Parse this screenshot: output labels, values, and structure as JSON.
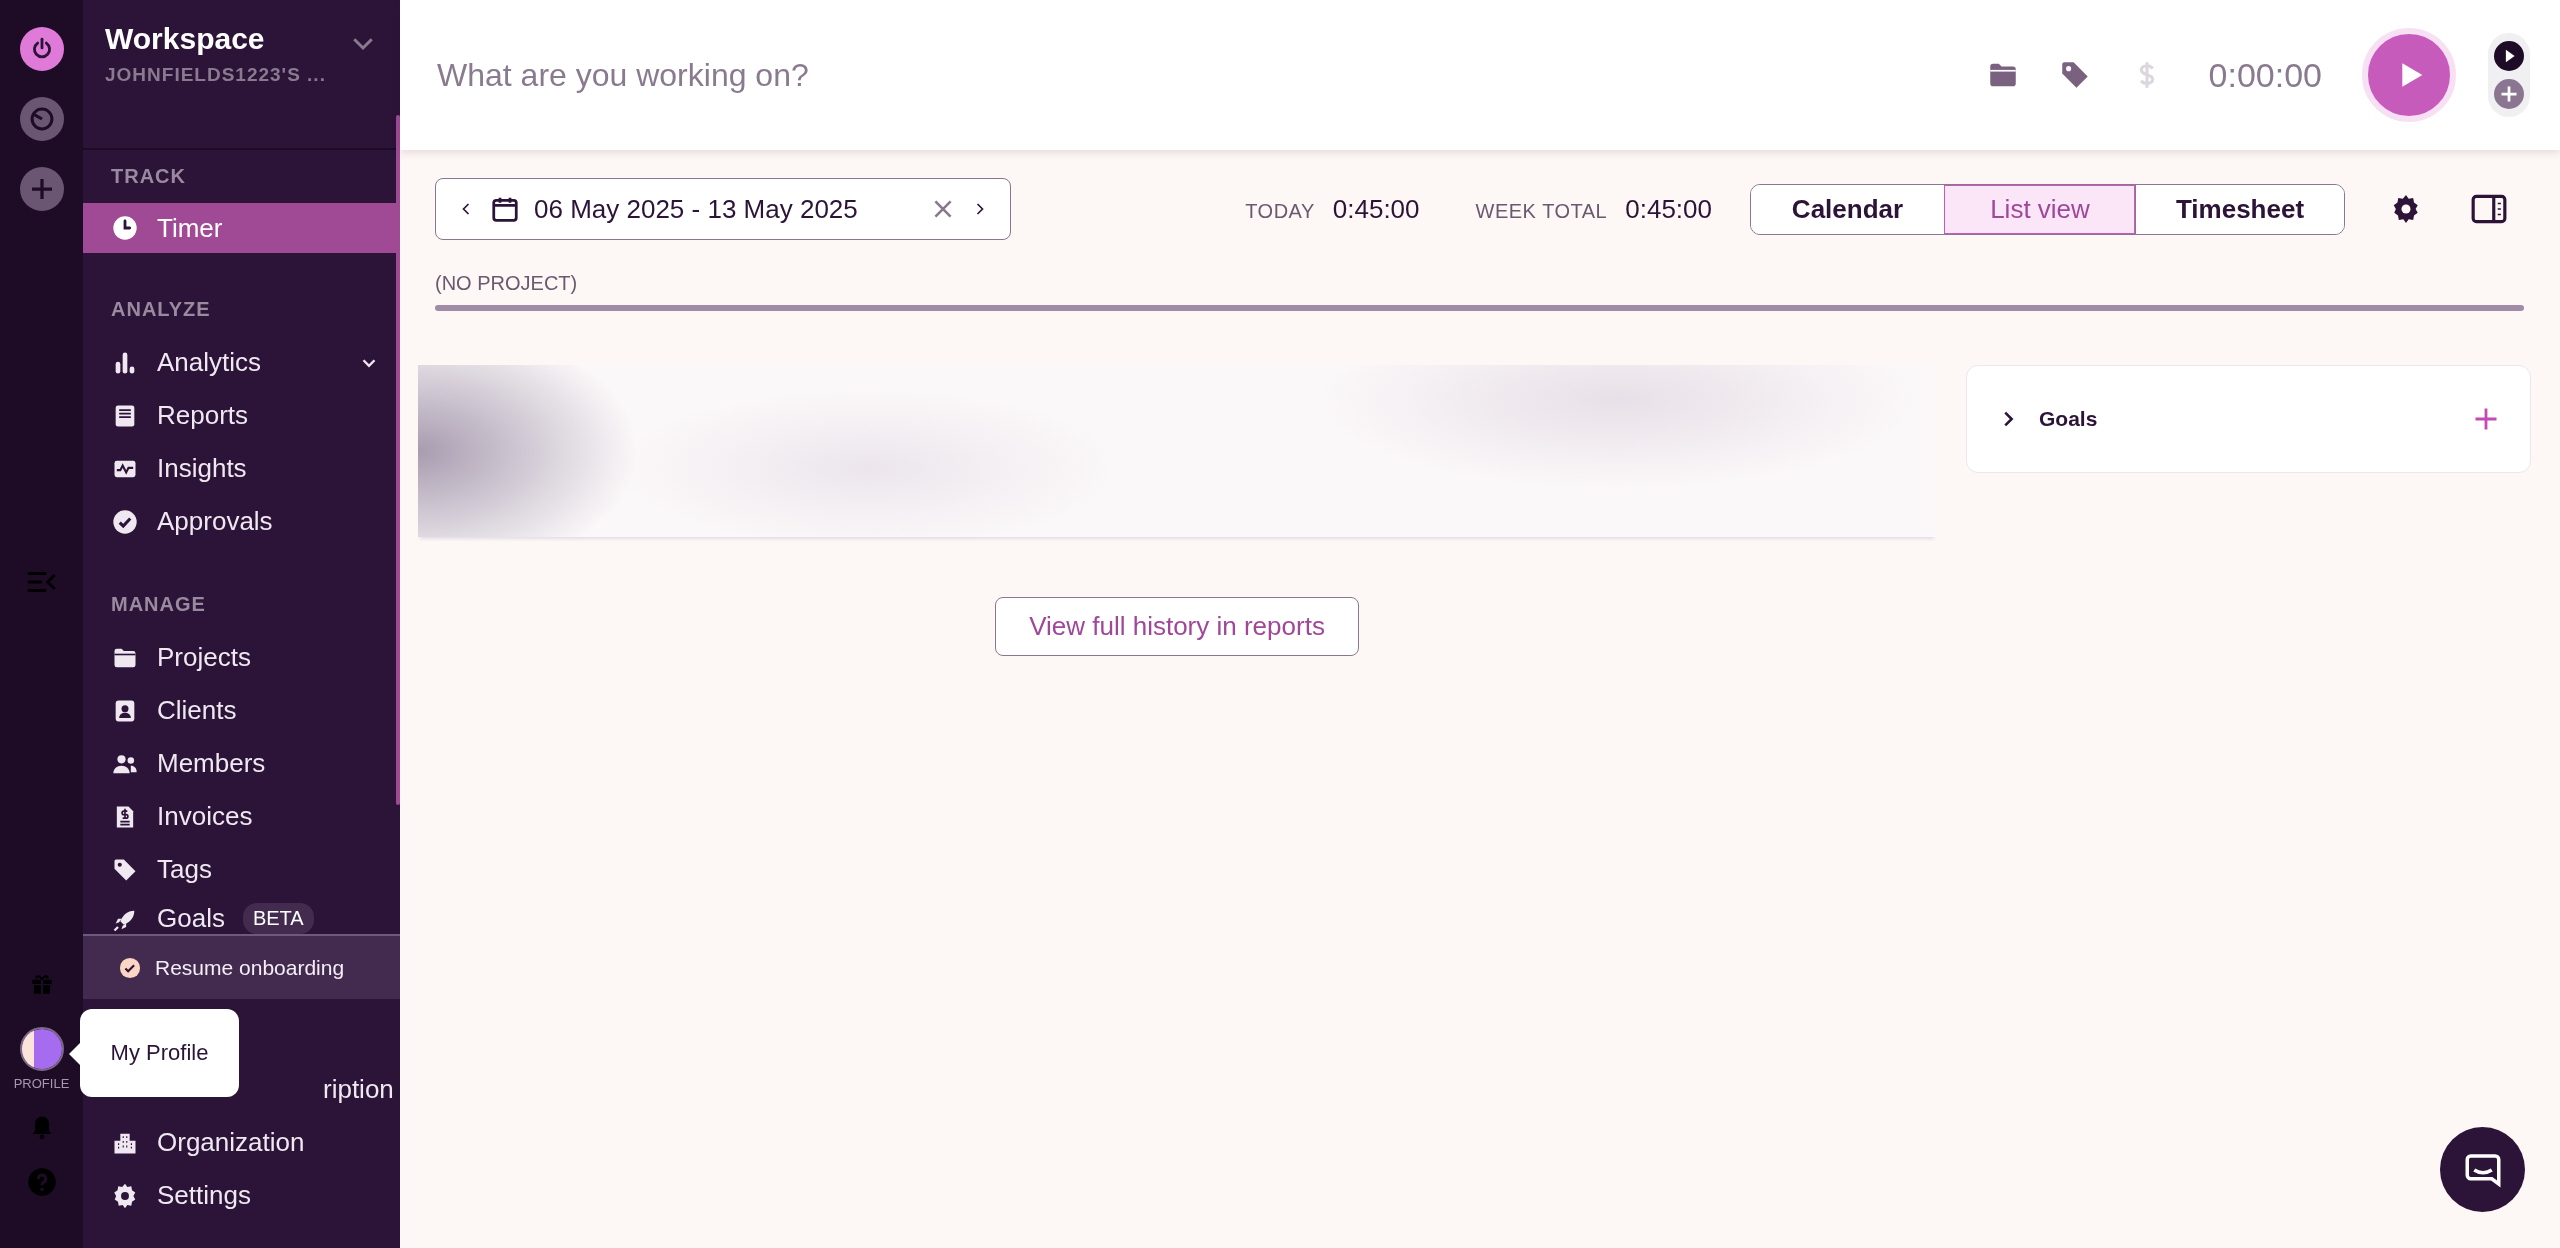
{
  "rail": {
    "profile_label": "PROFILE"
  },
  "tooltip": {
    "text": "My Profile"
  },
  "workspace": {
    "title": "Workspace",
    "subtitle": "JOHNFIELDS1223'S ..."
  },
  "sidebar": {
    "sections": [
      {
        "title": "TRACK",
        "items": [
          {
            "label": "Timer",
            "selected": true
          }
        ]
      },
      {
        "title": "ANALYZE",
        "items": [
          {
            "label": "Analytics",
            "selected": false,
            "expanded": false
          },
          {
            "label": "Reports",
            "selected": false
          },
          {
            "label": "Insights",
            "selected": false
          },
          {
            "label": "Approvals",
            "selected": false
          }
        ]
      },
      {
        "title": "MANAGE",
        "items": [
          {
            "label": "Projects",
            "selected": false
          },
          {
            "label": "Clients",
            "selected": false
          },
          {
            "label": "Members",
            "selected": false
          },
          {
            "label": "Invoices",
            "selected": false
          },
          {
            "label": "Tags",
            "selected": false
          },
          {
            "label": "Goals",
            "selected": false,
            "badge": "BETA"
          }
        ]
      },
      {
        "items": [
          {
            "label": "ription",
            "selected": false,
            "kind": "covered"
          },
          {
            "label": "Organization",
            "selected": false
          },
          {
            "label": "Settings",
            "selected": false
          }
        ]
      }
    ]
  },
  "onboarding": {
    "label": "Resume onboarding"
  },
  "timer_bar": {
    "placeholder": "What are you working on?",
    "billable": false,
    "time": "0:00:00"
  },
  "toolbar": {
    "date_range": "06 May 2025 - 13 May 2025",
    "stats": [
      {
        "label": "TODAY",
        "value": "0:45:00"
      },
      {
        "label": "WEEK TOTAL",
        "value": "0:45:00"
      }
    ],
    "views": [
      {
        "label": "Calendar",
        "selected": false
      },
      {
        "label": "List view",
        "selected": true
      },
      {
        "label": "Timesheet",
        "selected": false
      }
    ]
  },
  "project_summary": {
    "label": "(NO PROJECT)"
  },
  "goals_panel": {
    "title": "Goals",
    "expanded": false
  },
  "history_button": {
    "label": "View full history in reports"
  }
}
